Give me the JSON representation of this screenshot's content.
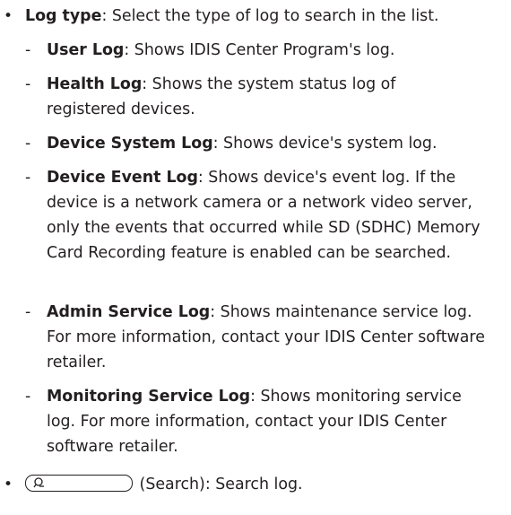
{
  "items": [
    {
      "term": "Log type",
      "text": ": Select the type of log to search in the list.",
      "sub": [
        {
          "term": "User Log",
          "text": ": Shows IDIS Center Program's log."
        },
        {
          "term": "Health Log",
          "text": ": Shows the system status log of registered devices."
        },
        {
          "term": "Device System Log",
          "text": ": Shows device's system log."
        },
        {
          "term": "Device Event Log",
          "text": ": Shows device's event log. If the device is a network camera or a network video server, only the events that occurred while SD (SDHC) Memory Card Recording feature is enabled can be searched."
        },
        {
          "term": "Admin Service Log",
          "text": ": Shows maintenance service log. For more information, contact your IDIS Center software retailer."
        },
        {
          "term": "Monitoring Service Log",
          "text": ": Shows monitoring service log. For more information, contact your IDIS Center software retailer."
        }
      ]
    },
    {
      "icon": "search-icon",
      "text": " (Search): Search log."
    }
  ],
  "bullet_char": "•",
  "dash_char": "-"
}
